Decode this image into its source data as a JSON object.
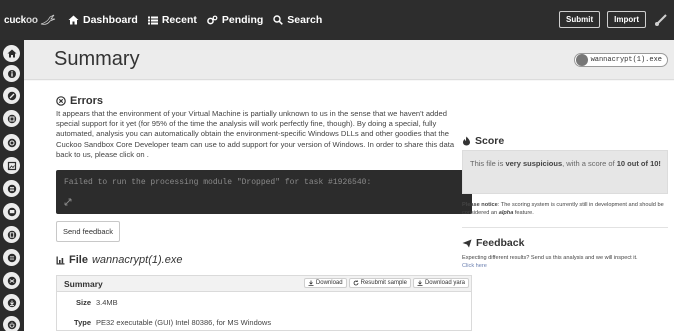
{
  "brand": {
    "logo_main": "cuck",
    "logo_accent": "oo"
  },
  "nav": {
    "items": [
      {
        "label": "Dashboard",
        "icon": "home-icon"
      },
      {
        "label": "Recent",
        "icon": "list-icon"
      },
      {
        "label": "Pending",
        "icon": "gears-icon"
      },
      {
        "label": "Search",
        "icon": "search-icon"
      }
    ],
    "submit_label": "Submit",
    "import_label": "Import"
  },
  "sidebar": {
    "icons": [
      "home-icon",
      "info-icon",
      "pencil-icon",
      "signature-icon",
      "target-icon",
      "image-icon",
      "list-icon",
      "flag-icon",
      "folder-icon",
      "list-alt-icon",
      "shuffle-icon",
      "download-icon",
      "power-icon"
    ]
  },
  "page": {
    "title": "Summary",
    "file_pill": "wannacrypt(1).exe"
  },
  "errors": {
    "title": "Errors",
    "text": "It appears that the environment of your Virtual Machine is partially unknown to us in the sense that we haven't added special support for it yet (for 95% of the time the analysis will work perfectly fine, though). By doing a special, fully automated, analysis you can automatically obtain the environment-specific Windows DLLs and other goodies that the Cuckoo Sandbox Core Developer team can use to add support for your version of Windows. In order to share this data back to us, please click on .",
    "console_message": "Failed to run the processing module \"Dropped\" for task #1926540:",
    "send_feedback_label": "Send feedback"
  },
  "file": {
    "heading_label": "File",
    "heading_name": "wannacrypt(1).exe",
    "summary_title": "Summary",
    "buttons": {
      "download": "Download",
      "resubmit": "Resubmit sample",
      "download_yara": "Download yara"
    },
    "rows": [
      {
        "key": "Size",
        "value": "3.4MB"
      },
      {
        "key": "Type",
        "value": "PE32 executable (GUI) Intel 80386, for MS Windows"
      }
    ]
  },
  "score": {
    "title": "Score",
    "prefix": "This file is ",
    "verdict": "very suspicious",
    "middle": ", with a score of ",
    "value": "10 out of 10!",
    "notice_label": "Please notice",
    "notice_text": ": The scoring system is currently still in development and should be considered an ",
    "notice_alpha": "alpha",
    "notice_end": " feature."
  },
  "feedback": {
    "title": "Feedback",
    "text": "Expecting different results? Send us this analysis and we will inspect it.",
    "link": "Click here"
  },
  "colors": {
    "navbar_bg": "#2d2d2d",
    "sidebar_bg": "#2b2b2b",
    "console_bg": "#2c2c2c",
    "score_bg": "#e6e6e6",
    "link": "#6a7fb0"
  }
}
